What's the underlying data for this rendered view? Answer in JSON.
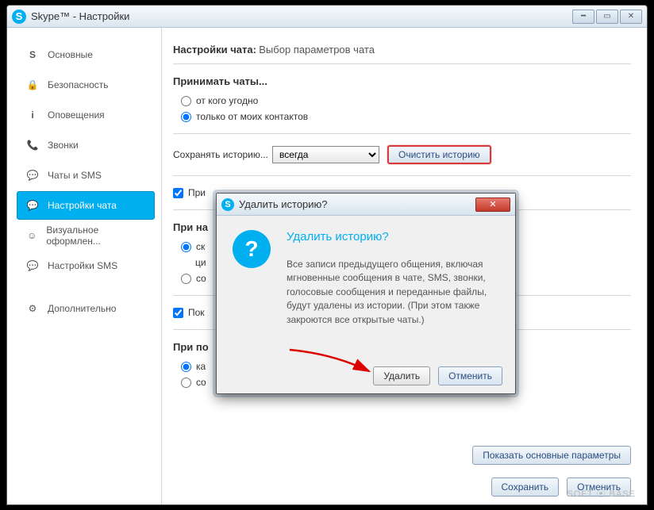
{
  "window": {
    "title": "Skype™ - Настройки"
  },
  "sidebar": {
    "items": [
      {
        "label": "Основные",
        "icon": "S"
      },
      {
        "label": "Безопасность",
        "icon": "🔒"
      },
      {
        "label": "Оповещения",
        "icon": "i"
      },
      {
        "label": "Звонки",
        "icon": "📞"
      },
      {
        "label": "Чаты и SMS",
        "icon": "💬"
      },
      {
        "label": "Настройки чата",
        "icon": "💬"
      },
      {
        "label": "Визуальное оформлен...",
        "icon": "☺"
      },
      {
        "label": "Настройки SMS",
        "icon": "💬"
      },
      {
        "label": "Дополнительно",
        "icon": "⚙"
      }
    ]
  },
  "header": {
    "title": "Настройки чата:",
    "subtitle": "Выбор параметров чата"
  },
  "section1": {
    "title": "Принимать чаты...",
    "opt1": "от кого угодно",
    "opt2": "только от моих контактов"
  },
  "history": {
    "label": "Сохранять историю...",
    "value": "всегда",
    "clear": "Очистить историю"
  },
  "check1": "При",
  "section2": "При на",
  "r1": "ск",
  "r1b": "ци",
  "r2": "co",
  "check2": "Пок",
  "section3": "При по",
  "r3": "ка",
  "r4": "co",
  "footerBtn": "Показать основные параметры",
  "save": "Сохранить",
  "cancel": "Отменить",
  "modal": {
    "title": "Удалить историю?",
    "heading": "Удалить историю?",
    "body": "Все записи предыдущего общения, включая мгновенные сообщения в чате, SMS, звонки, голосовые сообщения и переданные файлы, будут удалены из истории. (При этом также закроются все открытые чаты.)",
    "delete": "Удалить",
    "cancel": "Отменить"
  },
  "watermark": "SOFT ⦿ BASE"
}
